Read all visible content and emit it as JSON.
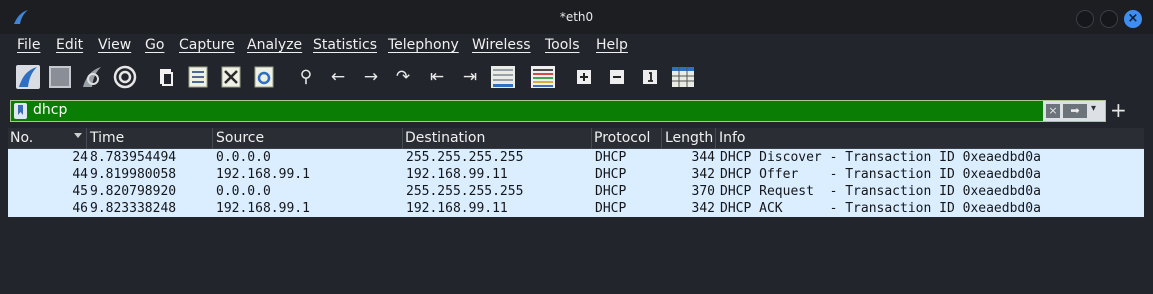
{
  "window": {
    "title": "*eth0",
    "close_glyph": "×"
  },
  "menu": [
    {
      "label": "File"
    },
    {
      "label": "Edit"
    },
    {
      "label": "View"
    },
    {
      "label": "Go"
    },
    {
      "label": "Capture"
    },
    {
      "label": "Analyze"
    },
    {
      "label": "Statistics"
    },
    {
      "label": "Telephony"
    },
    {
      "label": "Wireless"
    },
    {
      "label": "Tools"
    },
    {
      "label": "Help"
    }
  ],
  "toolbar": {
    "icons": [
      "start-capture-icon",
      "stop-capture-icon",
      "restart-capture-icon",
      "capture-options-icon",
      "open-file-icon",
      "save-file-icon",
      "close-file-icon",
      "reload-file-icon",
      "find-packet-icon",
      "go-back-icon",
      "go-forward-icon",
      "go-to-packet-icon",
      "first-packet-icon",
      "last-packet-icon",
      "autoscroll-icon",
      "colorize-icon",
      "zoom-in-icon",
      "zoom-out-icon",
      "normal-size-icon",
      "resize-columns-icon"
    ],
    "glyphs": {
      "find": "⚲",
      "back": "←",
      "forward": "→",
      "goto": "↷",
      "first": "⇤",
      "last": "⇥",
      "zoom_in": "+",
      "zoom_out": "−",
      "normal": "1"
    }
  },
  "filter": {
    "value": "dhcp",
    "clear_glyph": "×",
    "apply_glyph": "➡",
    "history_glyph": "▾",
    "add_glyph": "+",
    "background": "#0a7d05"
  },
  "packet_list": {
    "columns": [
      "No.",
      "Time",
      "Source",
      "Destination",
      "Protocol",
      "Length",
      "Info"
    ],
    "rows": [
      {
        "no": "24",
        "time": "8.783954494",
        "source": "0.0.0.0",
        "destination": "255.255.255.255",
        "protocol": "DHCP",
        "length": "344",
        "info": "DHCP Discover - Transaction ID 0xeaedbd0a"
      },
      {
        "no": "44",
        "time": "9.819980058",
        "source": "192.168.99.1",
        "destination": "192.168.99.11",
        "protocol": "DHCP",
        "length": "342",
        "info": "DHCP Offer    - Transaction ID 0xeaedbd0a"
      },
      {
        "no": "45",
        "time": "9.820798920",
        "source": "0.0.0.0",
        "destination": "255.255.255.255",
        "protocol": "DHCP",
        "length": "370",
        "info": "DHCP Request  - Transaction ID 0xeaedbd0a"
      },
      {
        "no": "46",
        "time": "9.823338248",
        "source": "192.168.99.1",
        "destination": "192.168.99.11",
        "protocol": "DHCP",
        "length": "342",
        "info": "DHCP ACK      - Transaction ID 0xeaedbd0a"
      }
    ],
    "row_color": "#daeeff"
  }
}
